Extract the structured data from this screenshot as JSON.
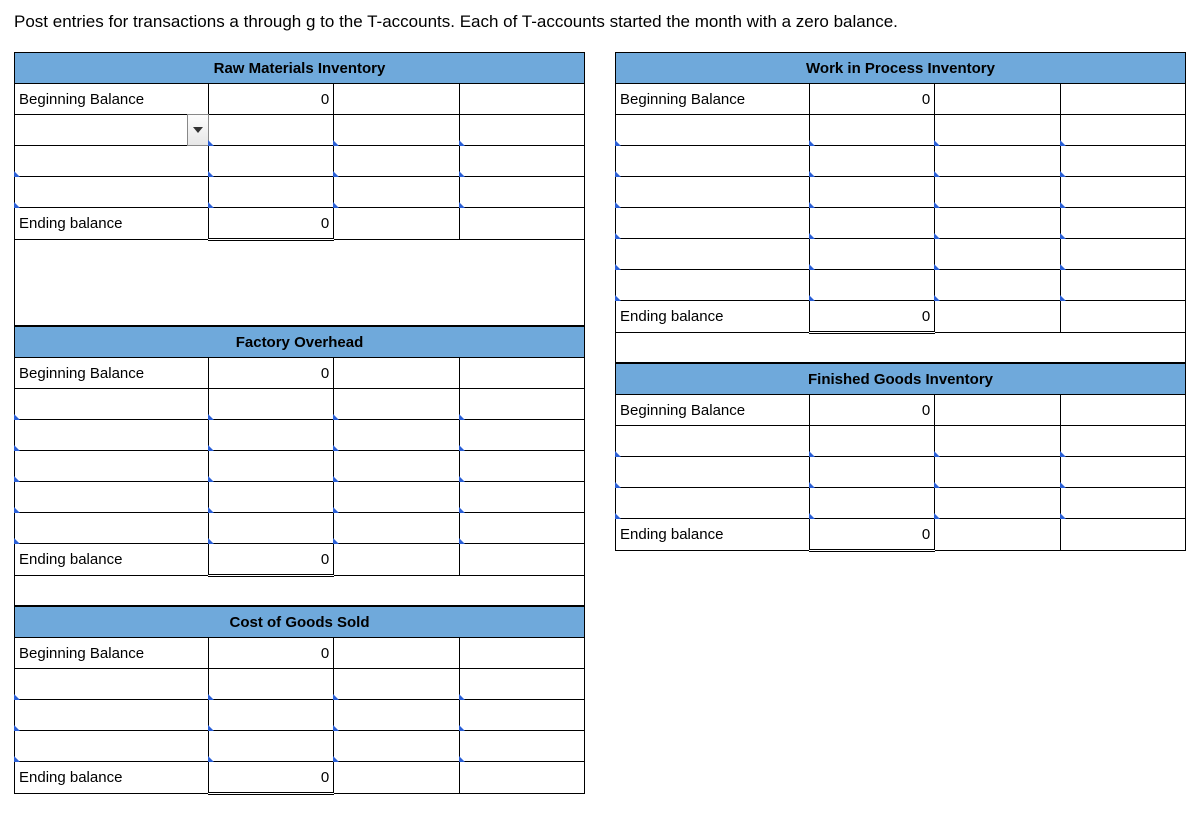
{
  "instruction": "Post entries for transactions a through g to the T-accounts. Each of T-accounts started the month with a zero balance.",
  "labels": {
    "beginning": "Beginning Balance",
    "ending": "Ending balance",
    "zero": "0"
  },
  "accounts": {
    "raw_materials": {
      "title": "Raw Materials Inventory",
      "input_rows": 3,
      "spacer_rows": 3
    },
    "factory_overhead": {
      "title": "Factory Overhead",
      "input_rows": 5,
      "spacer_rows": 1
    },
    "cogs": {
      "title": "Cost of Goods Sold",
      "input_rows": 3,
      "spacer_rows": 0
    },
    "wip": {
      "title": "Work in Process Inventory",
      "input_rows": 6,
      "spacer_rows": 1
    },
    "finished_goods": {
      "title": "Finished Goods Inventory",
      "input_rows": 3,
      "spacer_rows": 0
    }
  }
}
